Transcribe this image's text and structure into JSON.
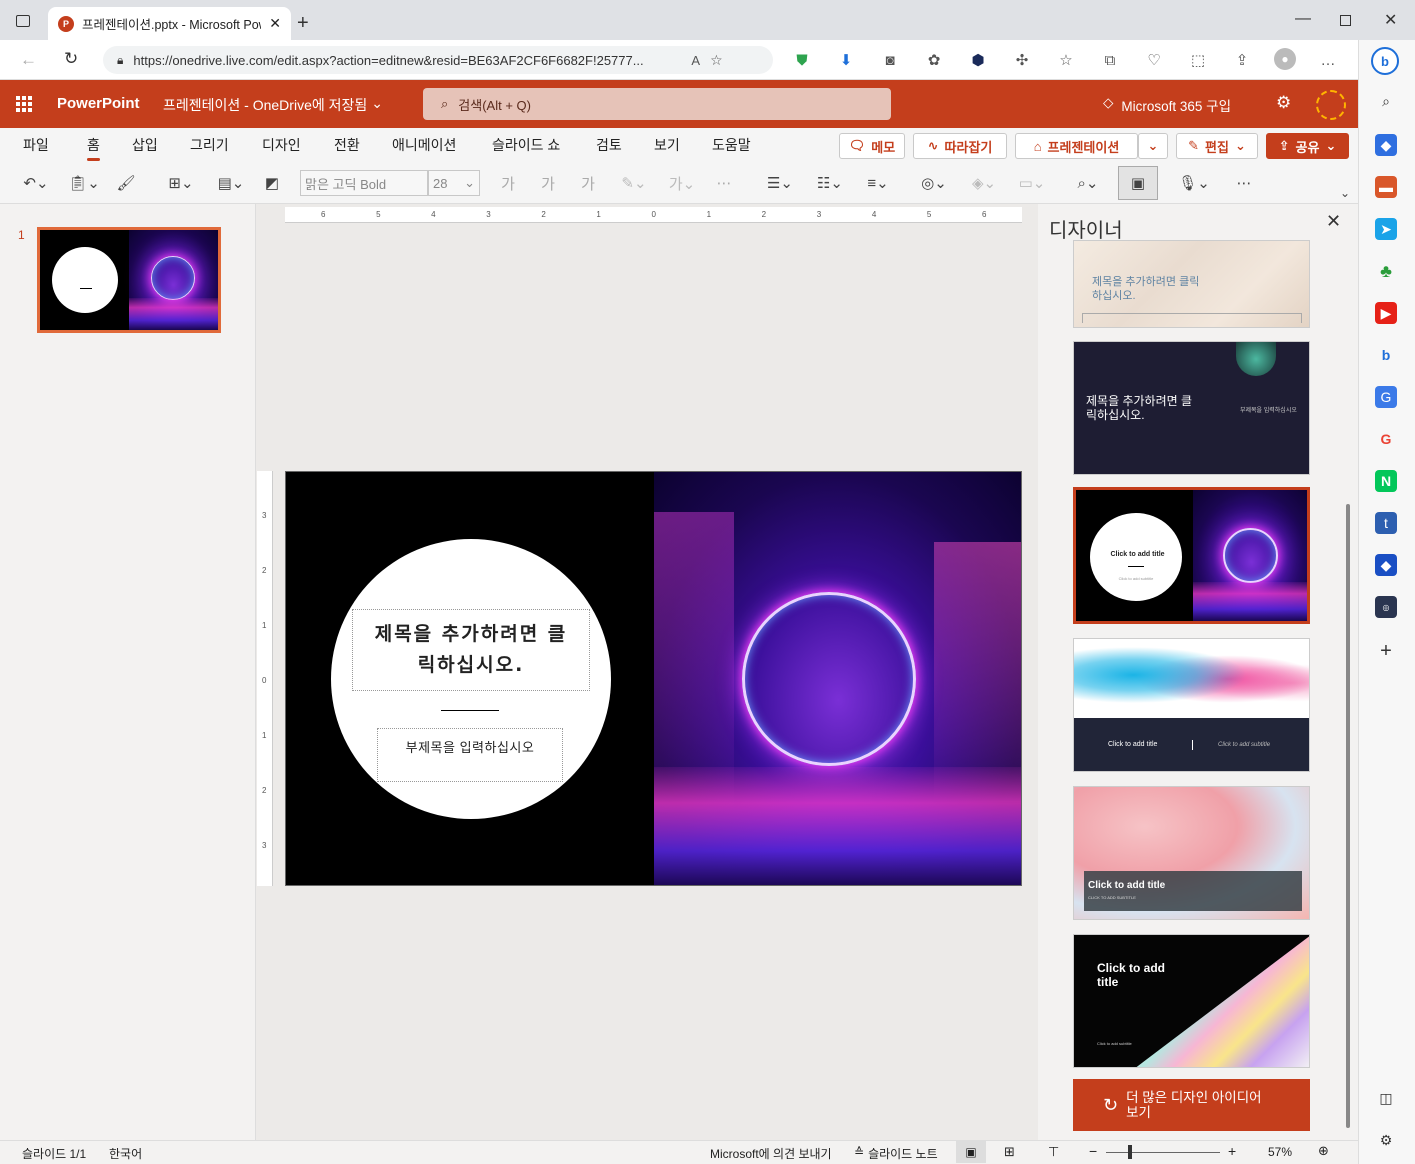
{
  "browser": {
    "tab_title": "프레젠테이션.pptx - Microsoft PowerPoint",
    "url": "https://onedrive.live.com/edit.aspx?action=editnew&resid=BE63AF2CF6F6682F!25777..."
  },
  "app": {
    "name": "PowerPoint",
    "doc_title": "프레젠테이션 - OneDrive에 저장됨",
    "search_placeholder": "검색(Alt + Q)",
    "buy_label": "Microsoft 365 구입"
  },
  "ribbon": {
    "tabs": [
      "파일",
      "홈",
      "삽입",
      "그리기",
      "디자인",
      "전환",
      "애니메이션",
      "슬라이드 쇼",
      "검토",
      "보기",
      "도움말"
    ],
    "memo": "메모",
    "catchup": "따라잡기",
    "present": "프레젠테이션",
    "edit": "편집",
    "share": "공유",
    "font_name": "맑은 고딕 Bold",
    "font_size": "28"
  },
  "thumbs": {
    "slide_number": "1"
  },
  "ruler": {
    "h_ticks": [
      "6",
      "5",
      "4",
      "3",
      "2",
      "1",
      "0",
      "1",
      "2",
      "3",
      "4",
      "5",
      "6"
    ],
    "v_ticks": [
      "3",
      "2",
      "1",
      "0",
      "1",
      "2",
      "3"
    ]
  },
  "slide": {
    "title": "제목을 추가하려면 클릭하십시오.",
    "subtitle": "부제목을 입력하십시오"
  },
  "designer": {
    "title": "디자이너",
    "card1_title": "제목을 추가하려면 클릭하십시오.",
    "card2_title": "제목을 추가하려면 클릭하십시오.",
    "card2_sub": "부제목을 입력하십시오",
    "card3_title": "Click to add title",
    "card3_sub": "Click to add subtitle",
    "card4_title": "Click to add title",
    "card4_sub": "Click to add subtitle",
    "card5_title": "Click to add title",
    "card5_sub": "CLICK TO ADD SUBTITLE",
    "card6_title": "Click to add title",
    "card6_sub": "Click to add subtitle",
    "more_button": "더 많은 디자인 아이디어 보기"
  },
  "status": {
    "slide_info": "슬라이드 1/1",
    "language": "한국어",
    "feedback": "Microsoft에 의견 보내기",
    "notes": "슬라이드 노트",
    "zoom": "57%"
  },
  "colors": {
    "accent": "#c43e1c",
    "ribbon_bg": "#f5f5f5",
    "canvas_bg": "#eceae8"
  }
}
